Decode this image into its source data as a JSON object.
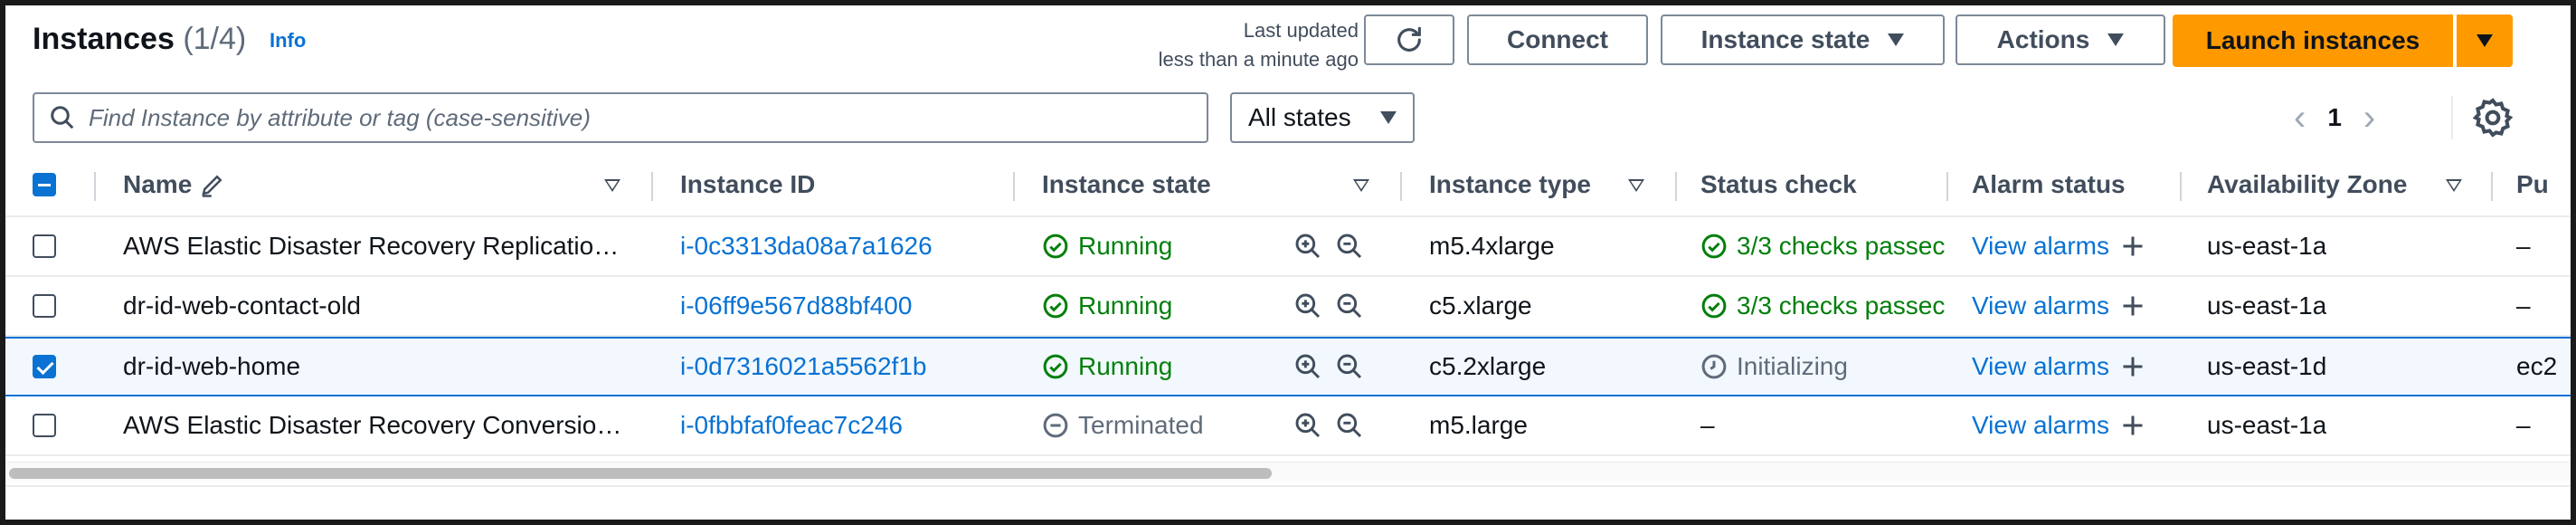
{
  "header": {
    "title": "Instances",
    "count": "(1/4)",
    "info": "Info",
    "last_updated_line1": "Last updated",
    "last_updated_line2": "less than a minute ago",
    "connect": "Connect",
    "instance_state": "Instance state",
    "actions": "Actions",
    "launch": "Launch instances"
  },
  "filter": {
    "search_placeholder": "Find Instance by attribute or tag (case-sensitive)",
    "states_value": "All states",
    "page": "1"
  },
  "columns": [
    "Name",
    "Instance ID",
    "Instance state",
    "Instance type",
    "Status check",
    "Alarm status",
    "Availability Zone",
    "Pu"
  ],
  "rows": [
    {
      "name": "AWS Elastic Disaster Recovery Replicatio…",
      "id": "i-0c3313da08a7a1626",
      "state": "Running",
      "type": "m5.4xlarge",
      "status": "3/3 checks passec",
      "alarm": "View alarms",
      "az": "us-east-1a",
      "pub": "–",
      "checked": false
    },
    {
      "name": "dr-id-web-contact-old",
      "id": "i-06ff9e567d88bf400",
      "state": "Running",
      "type": "c5.xlarge",
      "status": "3/3 checks passec",
      "alarm": "View alarms",
      "az": "us-east-1a",
      "pub": "–",
      "checked": false
    },
    {
      "name": "dr-id-web-home",
      "id": "i-0d7316021a5562f1b",
      "state": "Running",
      "type": "c5.2xlarge",
      "status": "Initializing",
      "alarm": "View alarms",
      "az": "us-east-1d",
      "pub": "ec2",
      "checked": true
    },
    {
      "name": "AWS Elastic Disaster Recovery Conversio…",
      "id": "i-0fbbfaf0feac7c246",
      "state": "Terminated",
      "type": "m5.large",
      "status": "–",
      "alarm": "View alarms",
      "az": "us-east-1a",
      "pub": "–",
      "checked": false
    }
  ],
  "colors": {
    "accent": "#0972d3",
    "launch": "#ff9900",
    "success": "#037f0c"
  }
}
